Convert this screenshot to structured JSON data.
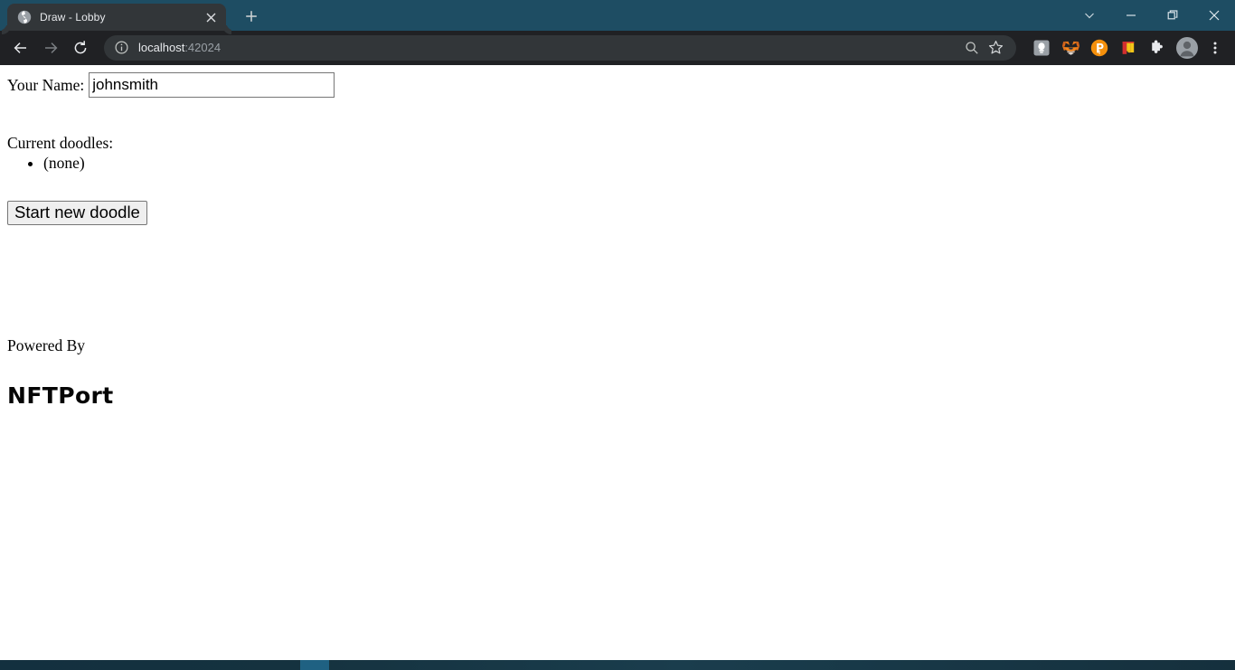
{
  "browser": {
    "tab": {
      "title": "Draw - Lobby",
      "favicon_name": "globe-favicon",
      "close_label": "×"
    },
    "new_tab_label": "+",
    "window_controls": {
      "tab_search_label": "tab-search",
      "minimize_label": "minimize",
      "maximize_label": "maximize",
      "close_label": "close"
    },
    "toolbar": {
      "back_label": "Back",
      "forward_label": "Forward",
      "reload_label": "Reload",
      "site_info_label": "View site information",
      "url_host": "localhost",
      "url_rest": ":42024",
      "url_full": "localhost:42024",
      "search_label": "Search with Google",
      "bookmark_label": "Bookmark this tab",
      "extensions_label": "Extensions",
      "profile_label": "Profile",
      "menu_label": "Customize and control Google Chrome",
      "extensions": [
        {
          "name": "reader-extension-icon",
          "label": "Reader"
        },
        {
          "name": "metamask-extension-icon",
          "label": "MetaMask"
        },
        {
          "name": "phantom-extension-icon",
          "label": "Phantom"
        },
        {
          "name": "wallet-extension-icon",
          "label": "Wallet"
        },
        {
          "name": "puzzle-extensions-icon",
          "label": "Extensions"
        }
      ]
    }
  },
  "colors": {
    "title_bar": "#1e4d63",
    "toolbar": "#202124",
    "tab_active": "#323639",
    "omnibox": "#323639",
    "url_host_text": "#e8eaed",
    "url_rest_text": "#9aa0a6",
    "page_background": "#ffffff",
    "taskbar": "#15323f",
    "taskbar_active": "#1f6182",
    "metamask_orange": "#e2761b",
    "phantom_orange": "#f5900c",
    "wallet_red": "#d32f2f",
    "wallet_yellow": "#f5c518"
  },
  "page": {
    "name_label": "Your Name:",
    "name_value": "johnsmith",
    "name_placeholder": "",
    "doodles_heading": "Current doodles:",
    "doodles": [
      "(none)"
    ],
    "start_button_label": "Start new doodle",
    "powered_by_label": "Powered By",
    "brand_name": "NFTPort"
  },
  "taskbar": {
    "active_item_label": "active-window"
  }
}
